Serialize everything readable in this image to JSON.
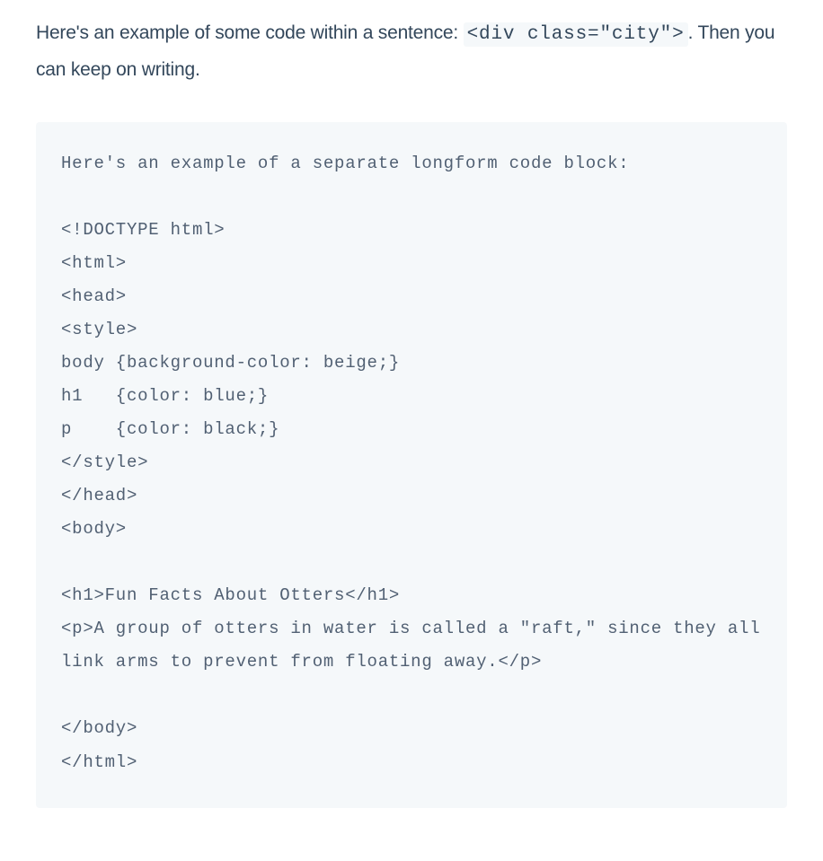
{
  "intro": {
    "text_before_code": "Here's an example of some code within a sentence: ",
    "inline_code": "<div class=\"city\">",
    "text_after_code": ". Then you can keep on writing."
  },
  "code_block": {
    "content": "Here's an example of a separate longform code block:\n\n<!DOCTYPE html>\n<html>\n<head>\n<style>\nbody {background-color: beige;}\nh1   {color: blue;}\np    {color: black;}\n</style>\n</head>\n<body>\n\n<h1>Fun Facts About Otters</h1>\n<p>A group of otters in water is called a \"raft,\" since they all link arms to prevent from floating away.</p>\n\n</body>\n</html>"
  }
}
